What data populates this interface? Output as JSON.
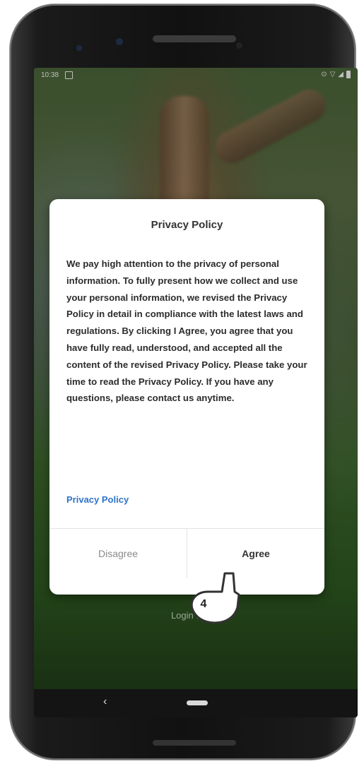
{
  "status_bar": {
    "time": "10:38"
  },
  "dialog": {
    "title": "Privacy Policy",
    "body": "We pay high attention to the privacy of personal information. To fully present how we collect and use your personal information, we revised the Privacy Policy in detail in compliance with the latest laws and regulations. By clicking I Agree, you agree that you have fully read, understood, and accepted all the content of the revised Privacy Policy. Please take your time to read the Privacy Policy. If you have any questions, please contact us anytime.",
    "link": "Privacy Policy",
    "disagree_label": "Disagree",
    "agree_label": "Agree"
  },
  "background": {
    "login_text": "Login with F"
  },
  "callout": {
    "step": "4"
  },
  "colors": {
    "link": "#2f73c9",
    "dialog_bg": "#ffffff",
    "phone_body": "#111111"
  }
}
